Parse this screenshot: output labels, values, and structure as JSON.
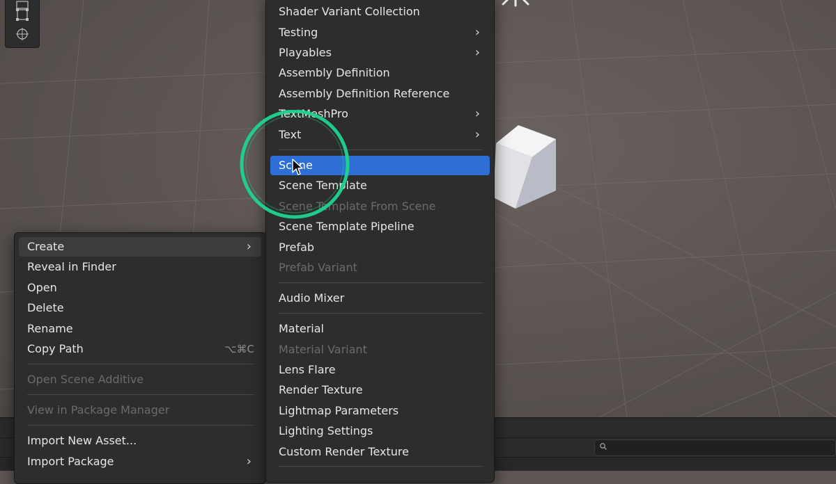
{
  "context_menu": {
    "items": [
      {
        "label": "Create",
        "submenu": true,
        "state": "active"
      },
      {
        "label": "Reveal in Finder"
      },
      {
        "label": "Open"
      },
      {
        "label": "Delete"
      },
      {
        "label": "Rename"
      },
      {
        "label": "Copy Path",
        "shortcut": "⌥⌘C"
      },
      {
        "label": "Open Scene Additive",
        "state": "disabled"
      },
      {
        "label": "View in Package Manager",
        "state": "disabled"
      },
      {
        "label": "Import New Asset..."
      },
      {
        "label": "Import Package",
        "submenu": true
      }
    ]
  },
  "create_submenu": {
    "items": [
      {
        "label": "Shader Variant Collection"
      },
      {
        "label": "Testing",
        "submenu": true
      },
      {
        "label": "Playables",
        "submenu": true
      },
      {
        "label": "Assembly Definition"
      },
      {
        "label": "Assembly Definition Reference"
      },
      {
        "label": "TextMeshPro",
        "submenu": true
      },
      {
        "label": "Text",
        "submenu": true
      },
      {
        "label": "Scene",
        "state": "selected"
      },
      {
        "label": "Scene Template"
      },
      {
        "label": "Scene Template From Scene",
        "state": "disabled"
      },
      {
        "label": "Scene Template Pipeline"
      },
      {
        "label": "Prefab"
      },
      {
        "label": "Prefab Variant",
        "state": "disabled"
      },
      {
        "label": "Audio Mixer"
      },
      {
        "label": "Material"
      },
      {
        "label": "Material Variant",
        "state": "disabled"
      },
      {
        "label": "Lens Flare"
      },
      {
        "label": "Render Texture"
      },
      {
        "label": "Lightmap Parameters"
      },
      {
        "label": "Lighting Settings"
      },
      {
        "label": "Custom Render Texture"
      }
    ]
  },
  "submenu_glyph": "›",
  "colors": {
    "menu_bg": "#2e2d2d",
    "selection": "#2e6fd6",
    "highlight_ring": "#1fd38f",
    "disabled_text": "#6c6b6b",
    "scene_bg": "#5d5654"
  },
  "icons": [
    "move-tool-icon",
    "rect-tool-icon",
    "transform-tool-icon",
    "search-icon",
    "mouse-cursor-icon",
    "chevron-right-icon"
  ]
}
